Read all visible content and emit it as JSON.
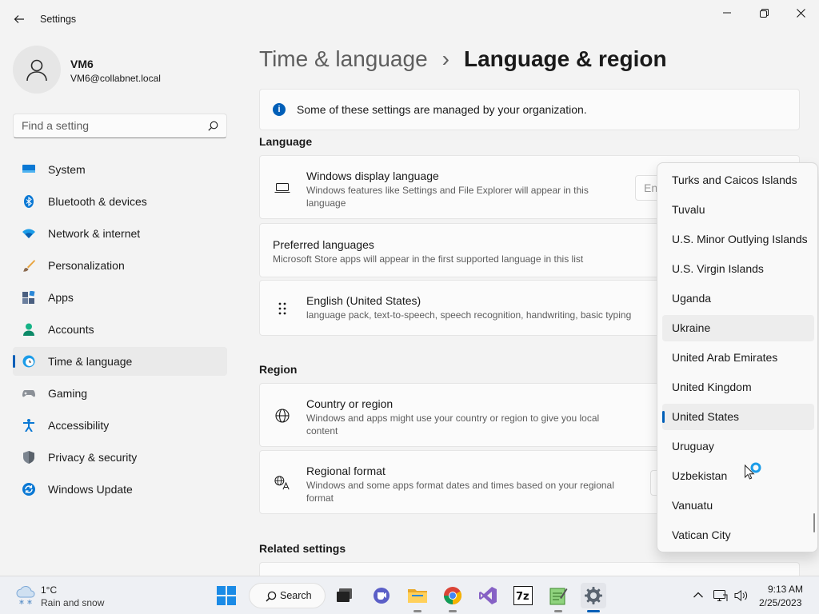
{
  "window": {
    "title": "Settings"
  },
  "profile": {
    "name": "VM6",
    "email": "VM6@collabnet.local"
  },
  "search": {
    "placeholder": "Find a setting"
  },
  "sidebar": {
    "items": [
      {
        "label": "System",
        "icon": "system-icon"
      },
      {
        "label": "Bluetooth & devices",
        "icon": "bluetooth-icon"
      },
      {
        "label": "Network & internet",
        "icon": "wifi-icon"
      },
      {
        "label": "Personalization",
        "icon": "brush-icon"
      },
      {
        "label": "Apps",
        "icon": "apps-icon"
      },
      {
        "label": "Accounts",
        "icon": "account-icon"
      },
      {
        "label": "Time & language",
        "icon": "clock-globe-icon",
        "selected": true
      },
      {
        "label": "Gaming",
        "icon": "gamepad-icon"
      },
      {
        "label": "Accessibility",
        "icon": "accessibility-icon"
      },
      {
        "label": "Privacy & security",
        "icon": "shield-icon"
      },
      {
        "label": "Windows Update",
        "icon": "update-icon"
      }
    ]
  },
  "breadcrumb": {
    "parent": "Time & language",
    "separator": "›",
    "current": "Language & region"
  },
  "info_bar": {
    "text": "Some of these settings are managed by your organization."
  },
  "language": {
    "section_title": "Language",
    "display_language": {
      "title": "Windows display language",
      "subtitle": "Windows features like Settings and File Explorer will appear in this language",
      "value": "En"
    },
    "preferred": {
      "title": "Preferred languages",
      "subtitle": "Microsoft Store apps will appear in the first supported language in this list"
    },
    "english": {
      "title": "English (United States)",
      "subtitle": "language pack, text-to-speech, speech recognition, handwriting, basic typing"
    }
  },
  "region": {
    "section_title": "Region",
    "country": {
      "title": "Country or region",
      "subtitle": "Windows and apps might use your country or region to give you local content"
    },
    "format": {
      "title": "Regional format",
      "subtitle": "Windows and some apps format dates and times based on your regional format"
    }
  },
  "related": {
    "section_title": "Related settings"
  },
  "dropdown": {
    "options": [
      "Turks and Caicos Islands",
      "Tuvalu",
      "U.S. Minor Outlying Islands",
      "U.S. Virgin Islands",
      "Uganda",
      "Ukraine",
      "United Arab Emirates",
      "United Kingdom",
      "United States",
      "Uruguay",
      "Uzbekistan",
      "Vanuatu",
      "Vatican City"
    ],
    "selected": "United States",
    "hovered": "Ukraine"
  },
  "taskbar": {
    "weather": {
      "temp": "1°C",
      "desc": "Rain and snow"
    },
    "search_label": "Search",
    "apps": [
      "start-icon",
      "task-view-icon",
      "teams-chat-icon",
      "file-explorer-icon",
      "chrome-icon",
      "visual-studio-icon",
      "7zip-icon",
      "notepad-icon",
      "settings-icon"
    ],
    "clock": {
      "time": "9:13 AM",
      "date": "2/25/2023"
    }
  },
  "colors": {
    "accent": "#005fb8",
    "background": "#f3f3f3",
    "card": "#fbfbfb"
  }
}
